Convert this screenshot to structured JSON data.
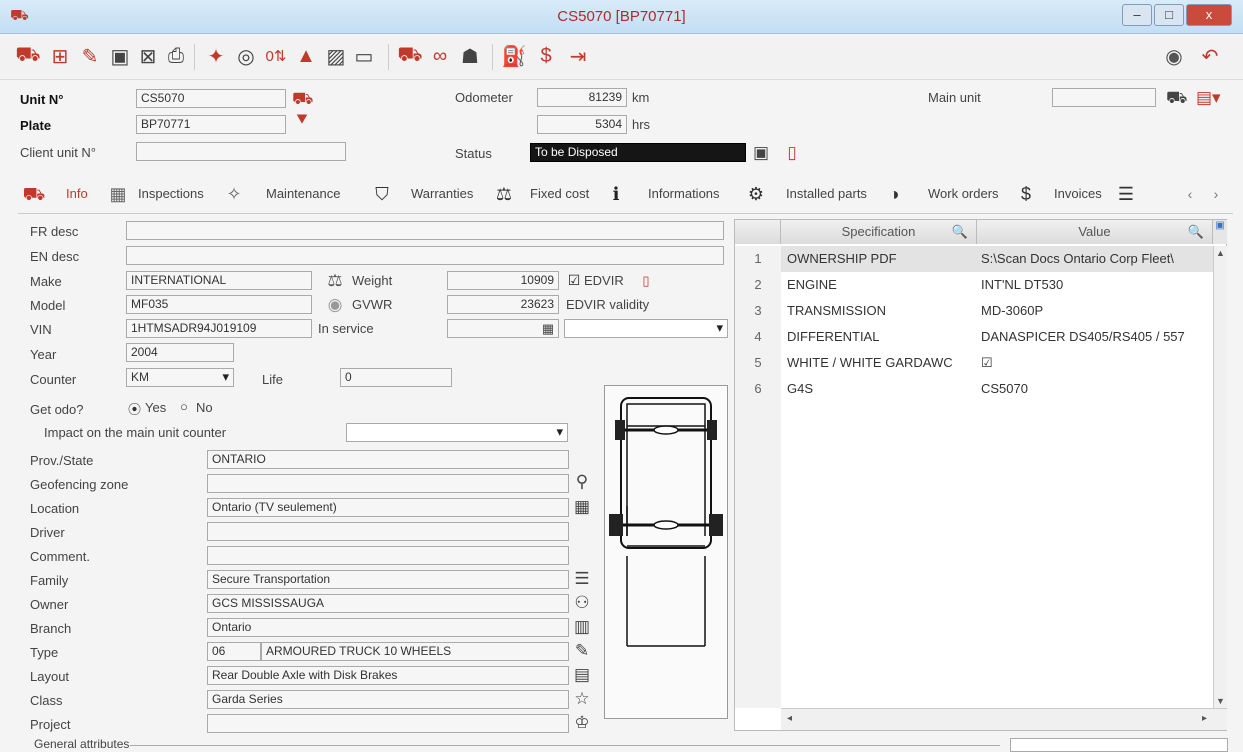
{
  "window": {
    "title": "CS5070 [BP70771]",
    "minimize": "–",
    "maximize": "□",
    "close": "x"
  },
  "toolbar": {
    "icons": [
      "truck-add-icon",
      "add-icon",
      "edit-icon",
      "save-icon",
      "cancel-icon",
      "print-icon",
      "pin-icon",
      "history-icon",
      "counter-icon",
      "cone-icon",
      "image-icon",
      "card-icon",
      "truck-icon",
      "binoculars-icon",
      "person-icon",
      "fuel-icon",
      "invoice-icon",
      "link-icon",
      "eye-icon",
      "undo-icon"
    ]
  },
  "header": {
    "unit_no_label": "Unit N°",
    "unit_no": "CS5070",
    "plate_label": "Plate",
    "plate": "BP70771",
    "client_unit_label": "Client unit N°",
    "client_unit": "",
    "odometer_label": "Odometer",
    "odometer": "81239",
    "odometer_unit": "km",
    "hours": "5304",
    "hours_unit": "hrs",
    "status_label": "Status",
    "status": "To be Disposed",
    "main_unit_label": "Main unit",
    "main_unit": ""
  },
  "tabs": [
    {
      "label": "Info",
      "active": true
    },
    {
      "label": "Inspections"
    },
    {
      "label": "Maintenance"
    },
    {
      "label": "Warranties"
    },
    {
      "label": "Fixed cost"
    },
    {
      "label": "Informations"
    },
    {
      "label": "Installed parts"
    },
    {
      "label": "Work orders"
    },
    {
      "label": "Invoices"
    }
  ],
  "info": {
    "fr_desc_label": "FR desc",
    "fr_desc": "",
    "en_desc_label": "EN desc",
    "en_desc": "",
    "make_label": "Make",
    "make": "INTERNATIONAL",
    "model_label": "Model",
    "model": "MF035",
    "vin_label": "VIN",
    "vin": "1HTMSADR94J019109",
    "year_label": "Year",
    "year": "2004",
    "counter_label": "Counter",
    "counter": "KM",
    "life_label": "Life",
    "life": "0",
    "weight_label": "Weight",
    "weight": "10909",
    "gvwr_label": "GVWR",
    "gvwr": "23623",
    "in_service_label": "In service",
    "in_service": "",
    "edvir_label": "EDVIR",
    "edvir_validity_label": "EDVIR validity",
    "edvir_validity": "",
    "get_odo_label": "Get odo?",
    "yes_label": "Yes",
    "no_label": "No",
    "get_odo": "Yes",
    "impact_label": "Impact on the main unit counter",
    "impact": "",
    "prov_label": "Prov./State",
    "prov": "ONTARIO",
    "geofence_label": "Geofencing zone",
    "geofence": "",
    "location_label": "Location",
    "location": "Ontario  (TV seulement)",
    "driver_label": "Driver",
    "driver": "",
    "comment_label": "Comment.",
    "comment": "",
    "family_label": "Family",
    "family": "Secure Transportation",
    "owner_label": "Owner",
    "owner": "GCS MISSISSAUGA",
    "branch_label": "Branch",
    "branch": "Ontario",
    "type_label": "Type",
    "type_code": "06",
    "type": "ARMOURED TRUCK 10 WHEELS",
    "layout_label": "Layout",
    "layout": "Rear Double Axle with Disk Brakes",
    "class_label": "Class",
    "class": "Garda Series",
    "project_label": "Project",
    "project": "",
    "general_attributes_label": "General attributes"
  },
  "specs": {
    "col_spec": "Specification",
    "col_value": "Value",
    "rows": [
      {
        "n": "1",
        "spec": "OWNERSHIP PDF",
        "value": "S:\\Scan Docs Ontario Corp Fleet\\"
      },
      {
        "n": "2",
        "spec": "ENGINE",
        "value": "INT'NL DT530"
      },
      {
        "n": "3",
        "spec": "TRANSMISSION",
        "value": "MD-3060P"
      },
      {
        "n": "4",
        "spec": "DIFFERENTIAL",
        "value": "DANASPICER DS405/RS405 / 557"
      },
      {
        "n": "5",
        "spec": "WHITE / WHITE GARDAWC",
        "value": "☑"
      },
      {
        "n": "6",
        "spec": "G4S",
        "value": "CS5070"
      }
    ]
  },
  "colors": {
    "accent_red": "#c0392b",
    "title_red": "#b02a2a",
    "status_bg": "#151515"
  }
}
